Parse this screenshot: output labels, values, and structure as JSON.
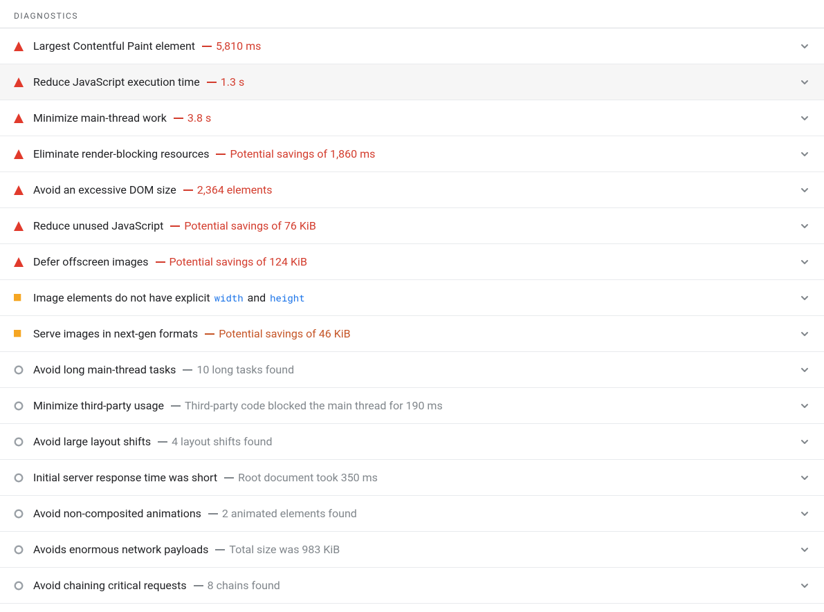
{
  "section_title": "DIAGNOSTICS",
  "items": [
    {
      "severity": "fail",
      "title": "Largest Contentful Paint element",
      "detail_color": "red",
      "detail": "5,810 ms",
      "hover": false
    },
    {
      "severity": "fail",
      "title": "Reduce JavaScript execution time",
      "detail_color": "red",
      "detail": "1.3 s",
      "hover": true
    },
    {
      "severity": "fail",
      "title": "Minimize main-thread work",
      "detail_color": "red",
      "detail": "3.8 s",
      "hover": false
    },
    {
      "severity": "fail",
      "title": "Eliminate render-blocking resources",
      "detail_color": "red",
      "detail": "Potential savings of 1,860 ms",
      "hover": false
    },
    {
      "severity": "fail",
      "title": "Avoid an excessive DOM size",
      "detail_color": "red",
      "detail": "2,364 elements",
      "hover": false
    },
    {
      "severity": "fail",
      "title": "Reduce unused JavaScript",
      "detail_color": "red",
      "detail": "Potential savings of 76 KiB",
      "hover": false
    },
    {
      "severity": "fail",
      "title": "Defer offscreen images",
      "detail_color": "red",
      "detail": "Potential savings of 124 KiB",
      "hover": false
    },
    {
      "severity": "average",
      "title_html": "Image elements do not have explicit <code class=\"inline\">width</code> and <code class=\"inline\">height</code>",
      "detail_color": "",
      "detail": "",
      "hover": false
    },
    {
      "severity": "average",
      "title": "Serve images in next-gen formats",
      "detail_color": "orange",
      "detail": "Potential savings of 46 KiB",
      "hover": false
    },
    {
      "severity": "info",
      "title": "Avoid long main-thread tasks",
      "detail_color": "gray",
      "detail": "10 long tasks found",
      "hover": false
    },
    {
      "severity": "info",
      "title": "Minimize third-party usage",
      "detail_color": "gray",
      "detail": "Third-party code blocked the main thread for 190 ms",
      "hover": false
    },
    {
      "severity": "info",
      "title": "Avoid large layout shifts",
      "detail_color": "gray",
      "detail": "4 layout shifts found",
      "hover": false
    },
    {
      "severity": "info",
      "title": "Initial server response time was short",
      "detail_color": "gray",
      "detail": "Root document took 350 ms",
      "hover": false
    },
    {
      "severity": "info",
      "title": "Avoid non-composited animations",
      "detail_color": "gray",
      "detail": "2 animated elements found",
      "hover": false
    },
    {
      "severity": "info",
      "title": "Avoids enormous network payloads",
      "detail_color": "gray",
      "detail": "Total size was 983 KiB",
      "hover": false
    },
    {
      "severity": "info",
      "title": "Avoid chaining critical requests",
      "detail_color": "gray",
      "detail": "8 chains found",
      "hover": false
    }
  ]
}
